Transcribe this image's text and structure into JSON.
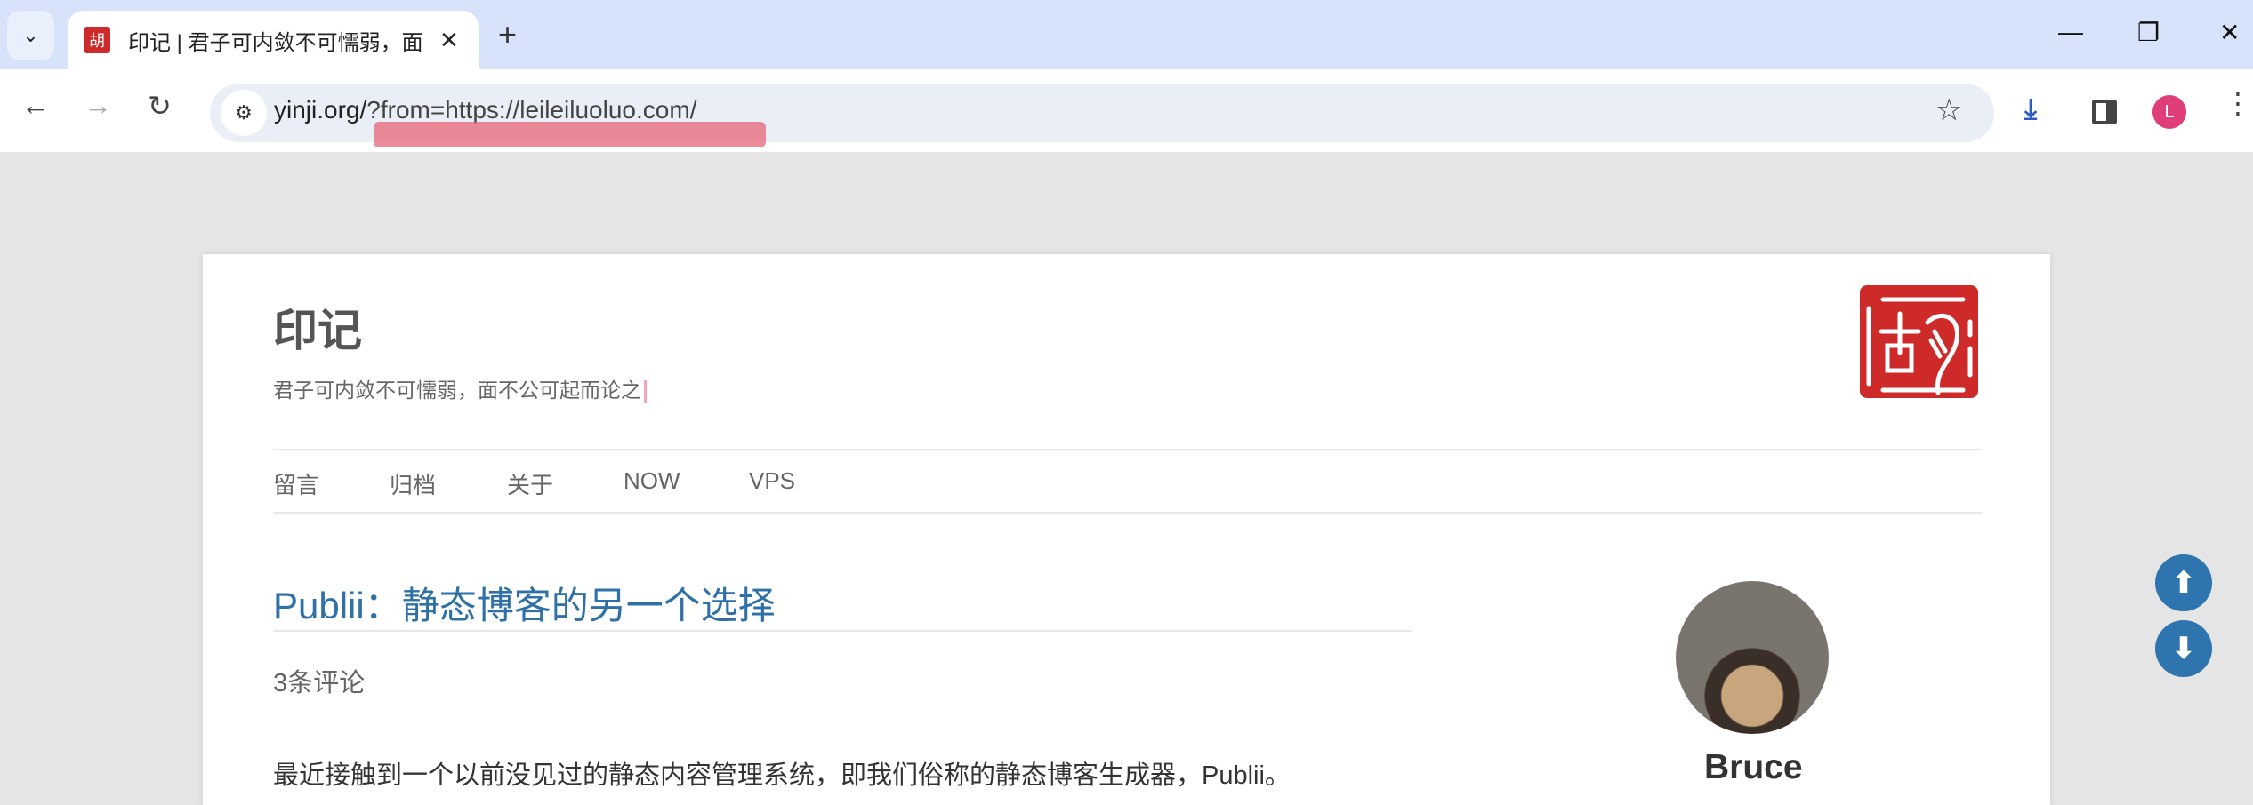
{
  "browser": {
    "tab_title": "印记 | 君子可内敛不可懦弱，面不公可起而论之",
    "url_host": "yinji.org/",
    "url_rest": "?from=https://leileiluoluo.com/",
    "profile_initial": "L"
  },
  "site": {
    "title": "印记",
    "subtitle": "君子可内敛不可懦弱，面不公可起而论之",
    "seal_char": "胡",
    "nav": [
      "留言",
      "归档",
      "关于",
      "NOW",
      "VPS"
    ]
  },
  "post": {
    "title": "Publii：静态博客的另一个选择",
    "comments": "3条评论",
    "first_line": "最近接触到一个以前没见过的静态内容管理系统，即我们俗称的静态博客生成器，Publii。"
  },
  "sidebar": {
    "author": "Bruce"
  },
  "colors": {
    "accent": "#2e74ae",
    "seal": "#cf2a2a",
    "tabbar": "#d6e3fa"
  }
}
